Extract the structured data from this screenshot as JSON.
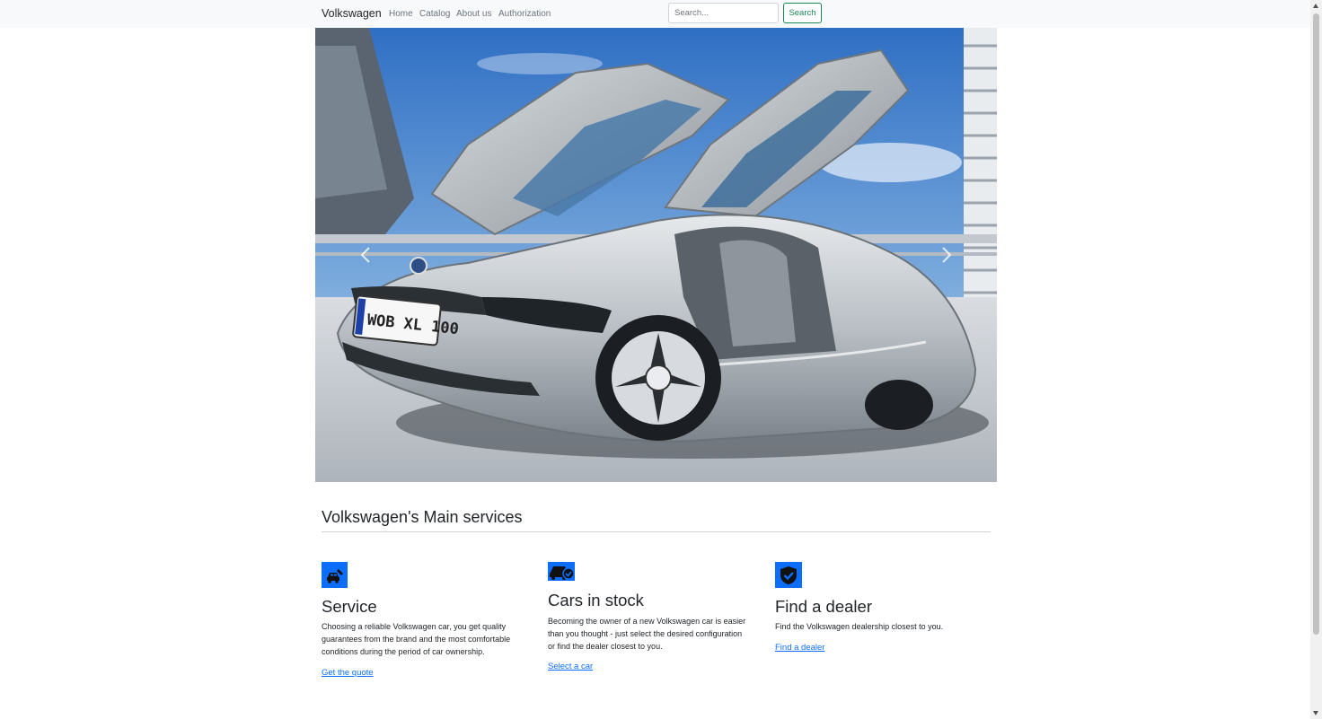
{
  "nav": {
    "brand": "Volkswagen",
    "links": [
      "Home",
      "Catalog",
      "About us",
      "Authorization"
    ],
    "search_placeholder": "Search...",
    "search_button": "Search"
  },
  "carousel": {
    "plate_text": "WOB XL 100",
    "prev_icon": "chevron-left-icon",
    "next_icon": "chevron-right-icon"
  },
  "services": {
    "heading": "Volkswagen's Main services",
    "items": [
      {
        "icon": "car-repair-icon",
        "title": "Service",
        "lines": [
          "Choosing a reliable Volkswagen car, you get quality",
          "guarantees from the brand and the most comfortable",
          "conditions during the period of car ownership."
        ],
        "link": "Get the quote"
      },
      {
        "icon": "car-check-icon",
        "title": "Cars in stock",
        "lines": [
          "Becoming the owner of a new Volkswagen car is easier",
          "than you thought - just select the desired configuration",
          "or find the dealer closest to you."
        ],
        "link": "Select a car"
      },
      {
        "icon": "shield-check-icon",
        "title": "Find a dealer",
        "lines": [
          "Find the Volkswagen dealership closest to you."
        ],
        "link": "Find a dealer"
      }
    ]
  },
  "colors": {
    "accent": "#0d6efd",
    "success": "#198754",
    "navbar_bg": "#f8f9fa"
  }
}
